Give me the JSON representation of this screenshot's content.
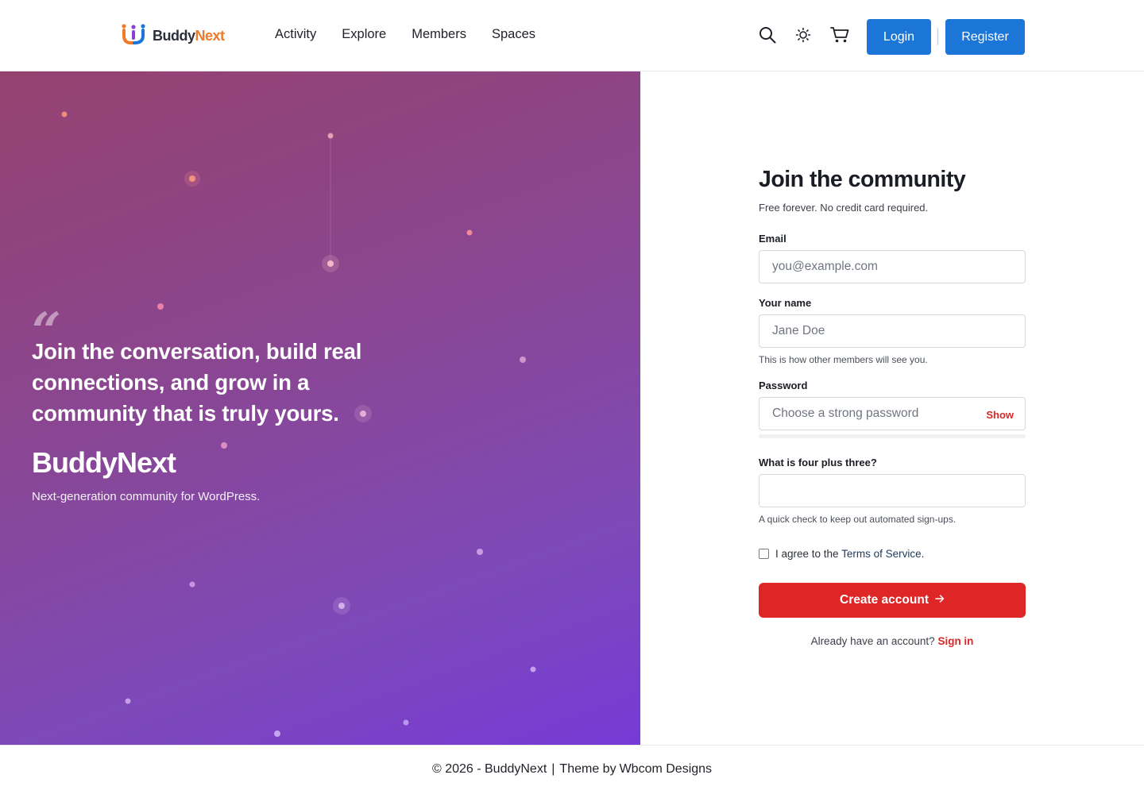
{
  "header": {
    "logo_part1": "Buddy",
    "logo_part2": "Next",
    "nav": [
      "Activity",
      "Explore",
      "Members",
      "Spaces"
    ],
    "login_label": "Login",
    "register_label": "Register",
    "icons": [
      "search-icon",
      "sun-icon",
      "cart-icon"
    ]
  },
  "hero": {
    "quote_mark": "“",
    "quote": "Join the conversation, build real connections, and grow in a community that is truly yours.",
    "brand": "BuddyNext",
    "tagline": "Next-generation community for WordPress."
  },
  "form": {
    "title": "Join the community",
    "subtitle": "Free forever. No credit card required.",
    "email_label": "Email",
    "email_placeholder": "you@example.com",
    "name_label": "Your name",
    "name_placeholder": "Jane Doe",
    "name_hint": "This is how other members will see you.",
    "password_label": "Password",
    "password_placeholder": "Choose a strong password",
    "show_label": "Show",
    "captcha_label": "What is four plus three?",
    "captcha_hint": "A quick check to keep out automated sign-ups.",
    "agree_prefix": "I agree to the ",
    "terms_link": "Terms of Service",
    "agree_suffix": ".",
    "submit_label": "Create account",
    "signin_prefix": "Already have an account?",
    "signin_link": "Sign in"
  },
  "footer": {
    "copyright": "© 2026 - BuddyNext",
    "separator": "|",
    "theme_prefix": "Theme by ",
    "theme_author": "Wbcom Designs"
  },
  "colors": {
    "accent_blue": "#1b76d8",
    "accent_red": "#de2626",
    "logo_orange": "#f07a2a",
    "hero_gradient_start": "#95426f",
    "hero_gradient_end": "#773ad6"
  }
}
